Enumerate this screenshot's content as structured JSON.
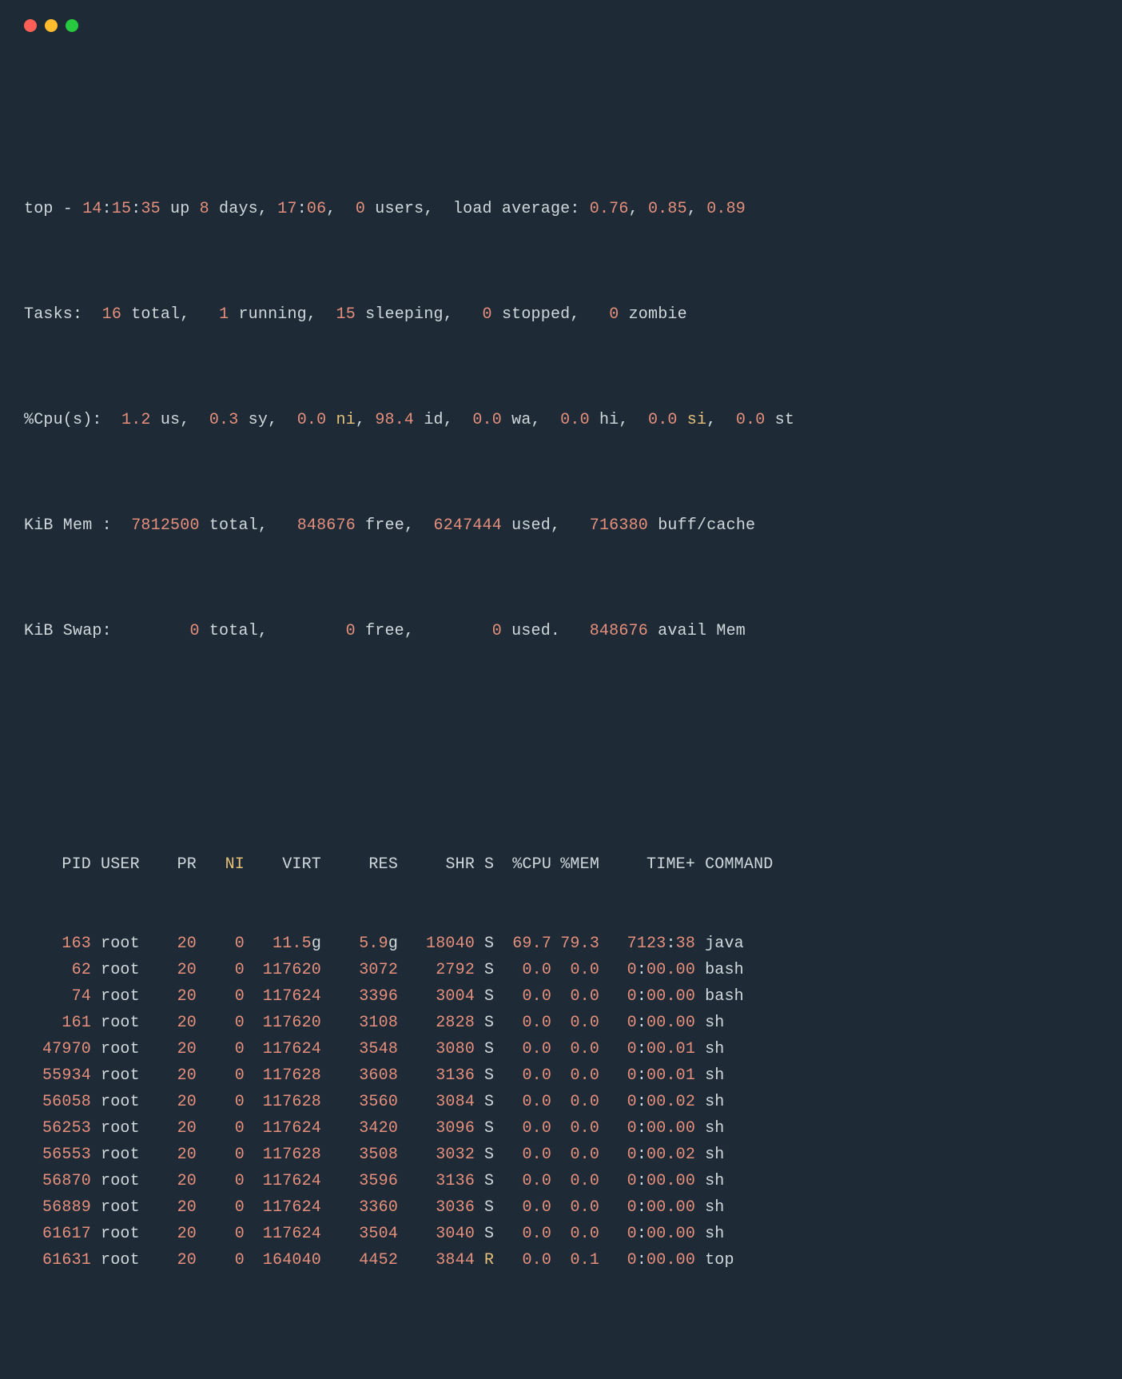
{
  "traffic_lights": [
    "red",
    "yellow",
    "green"
  ],
  "summary": {
    "line1": {
      "prefix": "top - ",
      "time_h": "14",
      "time_m": "15",
      "time_s": "35",
      "up_word": " up ",
      "up_days": "8",
      "days_word": " days, ",
      "up_hm": "17",
      "up_hm2": "06",
      "users_n": "0",
      "users_word": " users,  load average: ",
      "la1": "0.76",
      "la2": "0.85",
      "la3": "0.89"
    },
    "tasks": {
      "label": "Tasks:  ",
      "total": "16",
      "total_w": " total,   ",
      "running": "1",
      "running_w": " running,  ",
      "sleeping": "15",
      "sleeping_w": " sleeping,   ",
      "stopped": "0",
      "stopped_w": " stopped,   ",
      "zombie": "0",
      "zombie_w": " zombie"
    },
    "cpu": {
      "label": "%Cpu(s):  ",
      "us": "1.2",
      "us_w": " us,  ",
      "sy": "0.3",
      "sy_w": " sy,  ",
      "ni": "0.0",
      "ni_w": " ni",
      "id_pre": ", ",
      "id": "98.4",
      "id_w": " id,  ",
      "wa": "0.0",
      "wa_w": " wa,  ",
      "hi": "0.0",
      "hi_w": " hi,  ",
      "si": "0.0",
      "si_w": " si",
      "st_pre": ",  ",
      "st": "0.0",
      "st_w": " st"
    },
    "mem": {
      "label": "KiB Mem :  ",
      "total": "7812500",
      "total_w": " total,   ",
      "free": "848676",
      "free_w": " free,  ",
      "used": "6247444",
      "used_w": " used,   ",
      "buff": "716380",
      "buff_w": " buff/cache"
    },
    "swap": {
      "label": "KiB Swap:        ",
      "total": "0",
      "total_w": " total,        ",
      "free": "0",
      "free_w": " free,        ",
      "used": "0",
      "used_w": " used.   ",
      "avail": "848676",
      "avail_w": " avail Mem"
    }
  },
  "columns": {
    "pid": "PID",
    "user": "USER",
    "pr": "PR",
    "ni": "NI",
    "virt": "VIRT",
    "res": "RES",
    "shr": "SHR",
    "s": "S",
    "cpu": "%CPU",
    "mem": "%MEM",
    "time": "TIME+",
    "cmd": "COMMAND"
  },
  "rows": [
    {
      "pid": "163",
      "user": "root",
      "pr": "20",
      "ni": "0",
      "virt_n": "11.5",
      "virt_u": "g",
      "res_n": "5.9",
      "res_u": "g",
      "shr": "18040",
      "s": "S",
      "cpu": "69.7",
      "mem": "79.3",
      "time_a": "7123",
      "time_b": "38",
      "cmd": "java"
    },
    {
      "pid": "62",
      "user": "root",
      "pr": "20",
      "ni": "0",
      "virt_n": "117620",
      "virt_u": "",
      "res_n": "3072",
      "res_u": "",
      "shr": "2792",
      "s": "S",
      "cpu": "0.0",
      "mem": "0.0",
      "time_a": "0",
      "time_b": "00.00",
      "cmd": "bash"
    },
    {
      "pid": "74",
      "user": "root",
      "pr": "20",
      "ni": "0",
      "virt_n": "117624",
      "virt_u": "",
      "res_n": "3396",
      "res_u": "",
      "shr": "3004",
      "s": "S",
      "cpu": "0.0",
      "mem": "0.0",
      "time_a": "0",
      "time_b": "00.00",
      "cmd": "bash"
    },
    {
      "pid": "161",
      "user": "root",
      "pr": "20",
      "ni": "0",
      "virt_n": "117620",
      "virt_u": "",
      "res_n": "3108",
      "res_u": "",
      "shr": "2828",
      "s": "S",
      "cpu": "0.0",
      "mem": "0.0",
      "time_a": "0",
      "time_b": "00.00",
      "cmd": "sh"
    },
    {
      "pid": "47970",
      "user": "root",
      "pr": "20",
      "ni": "0",
      "virt_n": "117624",
      "virt_u": "",
      "res_n": "3548",
      "res_u": "",
      "shr": "3080",
      "s": "S",
      "cpu": "0.0",
      "mem": "0.0",
      "time_a": "0",
      "time_b": "00.01",
      "cmd": "sh"
    },
    {
      "pid": "55934",
      "user": "root",
      "pr": "20",
      "ni": "0",
      "virt_n": "117628",
      "virt_u": "",
      "res_n": "3608",
      "res_u": "",
      "shr": "3136",
      "s": "S",
      "cpu": "0.0",
      "mem": "0.0",
      "time_a": "0",
      "time_b": "00.01",
      "cmd": "sh"
    },
    {
      "pid": "56058",
      "user": "root",
      "pr": "20",
      "ni": "0",
      "virt_n": "117628",
      "virt_u": "",
      "res_n": "3560",
      "res_u": "",
      "shr": "3084",
      "s": "S",
      "cpu": "0.0",
      "mem": "0.0",
      "time_a": "0",
      "time_b": "00.02",
      "cmd": "sh"
    },
    {
      "pid": "56253",
      "user": "root",
      "pr": "20",
      "ni": "0",
      "virt_n": "117624",
      "virt_u": "",
      "res_n": "3420",
      "res_u": "",
      "shr": "3096",
      "s": "S",
      "cpu": "0.0",
      "mem": "0.0",
      "time_a": "0",
      "time_b": "00.00",
      "cmd": "sh"
    },
    {
      "pid": "56553",
      "user": "root",
      "pr": "20",
      "ni": "0",
      "virt_n": "117628",
      "virt_u": "",
      "res_n": "3508",
      "res_u": "",
      "shr": "3032",
      "s": "S",
      "cpu": "0.0",
      "mem": "0.0",
      "time_a": "0",
      "time_b": "00.02",
      "cmd": "sh"
    },
    {
      "pid": "56870",
      "user": "root",
      "pr": "20",
      "ni": "0",
      "virt_n": "117624",
      "virt_u": "",
      "res_n": "3596",
      "res_u": "",
      "shr": "3136",
      "s": "S",
      "cpu": "0.0",
      "mem": "0.0",
      "time_a": "0",
      "time_b": "00.00",
      "cmd": "sh"
    },
    {
      "pid": "56889",
      "user": "root",
      "pr": "20",
      "ni": "0",
      "virt_n": "117624",
      "virt_u": "",
      "res_n": "3360",
      "res_u": "",
      "shr": "3036",
      "s": "S",
      "cpu": "0.0",
      "mem": "0.0",
      "time_a": "0",
      "time_b": "00.00",
      "cmd": "sh"
    },
    {
      "pid": "61617",
      "user": "root",
      "pr": "20",
      "ni": "0",
      "virt_n": "117624",
      "virt_u": "",
      "res_n": "3504",
      "res_u": "",
      "shr": "3040",
      "s": "S",
      "cpu": "0.0",
      "mem": "0.0",
      "time_a": "0",
      "time_b": "00.00",
      "cmd": "sh"
    },
    {
      "pid": "61631",
      "user": "root",
      "pr": "20",
      "ni": "0",
      "virt_n": "164040",
      "virt_u": "",
      "res_n": "4452",
      "res_u": "",
      "shr": "3844",
      "s": "R",
      "s_yl": true,
      "cpu": "0.0",
      "mem": "0.1",
      "time_a": "0",
      "time_b": "00.00",
      "cmd": "top"
    }
  ]
}
